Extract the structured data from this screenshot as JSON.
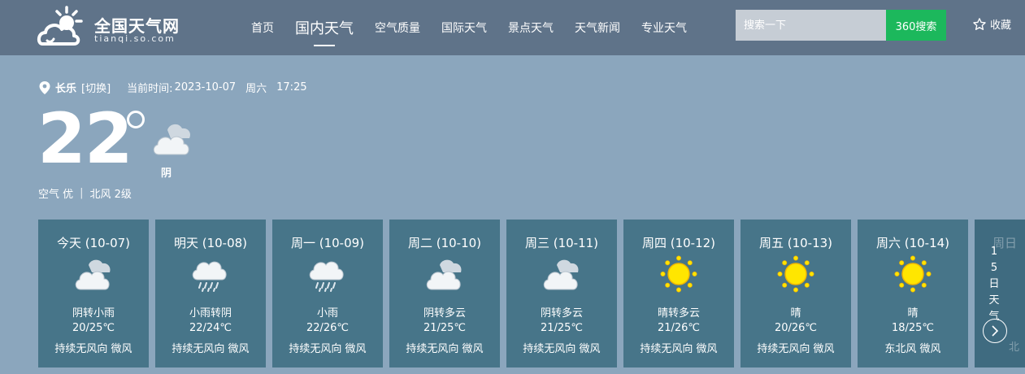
{
  "header": {
    "logo_title": "全国天气网",
    "logo_sub": "tianqi.so.com",
    "nav": [
      {
        "label": "首页",
        "active": false
      },
      {
        "label": "国内天气",
        "active": true
      },
      {
        "label": "空气质量",
        "active": false
      },
      {
        "label": "国际天气",
        "active": false
      },
      {
        "label": "景点天气",
        "active": false
      },
      {
        "label": "天气新闻",
        "active": false
      },
      {
        "label": "专业天气",
        "active": false
      }
    ],
    "search_placeholder": "搜索一下",
    "search_button": "360搜索",
    "favorite": "收藏",
    "icons": {
      "logo": "cloud-sun-logo-icon",
      "favorite": "star-outline-icon"
    }
  },
  "current": {
    "location_icon": "location-pin-icon",
    "city": "长乐",
    "switch_label": "[切换]",
    "time_label": "当前时间:",
    "date": "2023-10-07",
    "weekday": "周六",
    "time": "17:25",
    "temperature": "22",
    "condition": "阴",
    "condition_icon": "overcast-cloud-icon",
    "air_quality": "空气 优",
    "separator": "|",
    "wind": "北风 2级"
  },
  "forecast": [
    {
      "name": "今天 (10-07)",
      "icon": "cloud-icon",
      "cond": "阴转小雨",
      "temp": "20/25℃",
      "wind": "持续无风向 微风"
    },
    {
      "name": "明天 (10-08)",
      "icon": "rain-cloud-icon",
      "cond": "小雨转阴",
      "temp": "22/24℃",
      "wind": "持续无风向 微风"
    },
    {
      "name": "周一 (10-09)",
      "icon": "rain-cloud-icon",
      "cond": "小雨",
      "temp": "22/26℃",
      "wind": "持续无风向 微风"
    },
    {
      "name": "周二 (10-10)",
      "icon": "cloud-icon",
      "cond": "阴转多云",
      "temp": "21/25℃",
      "wind": "持续无风向 微风"
    },
    {
      "name": "周三 (10-11)",
      "icon": "cloud-icon",
      "cond": "阴转多云",
      "temp": "21/25℃",
      "wind": "持续无风向 微风"
    },
    {
      "name": "周四 (10-12)",
      "icon": "sun-icon",
      "cond": "晴转多云",
      "temp": "21/26℃",
      "wind": "持续无风向 微风"
    },
    {
      "name": "周五 (10-13)",
      "icon": "sun-icon",
      "cond": "晴",
      "temp": "20/26℃",
      "wind": "持续无风向 微风"
    },
    {
      "name": "周六 (10-14)",
      "icon": "sun-icon",
      "cond": "晴",
      "temp": "18/25℃",
      "wind": "东北风 微风"
    }
  ],
  "more": {
    "ghost_label": "周日",
    "label": "15日天气",
    "arrow_icon": "chevron-right-circle-icon",
    "ghost_bottom": "北"
  },
  "colors": {
    "header_bg": "#5f7389",
    "page_bg": "#8ba6bd",
    "card_bg": "#477589",
    "search_button": "#1cb85c",
    "sun": "#ffe600"
  }
}
